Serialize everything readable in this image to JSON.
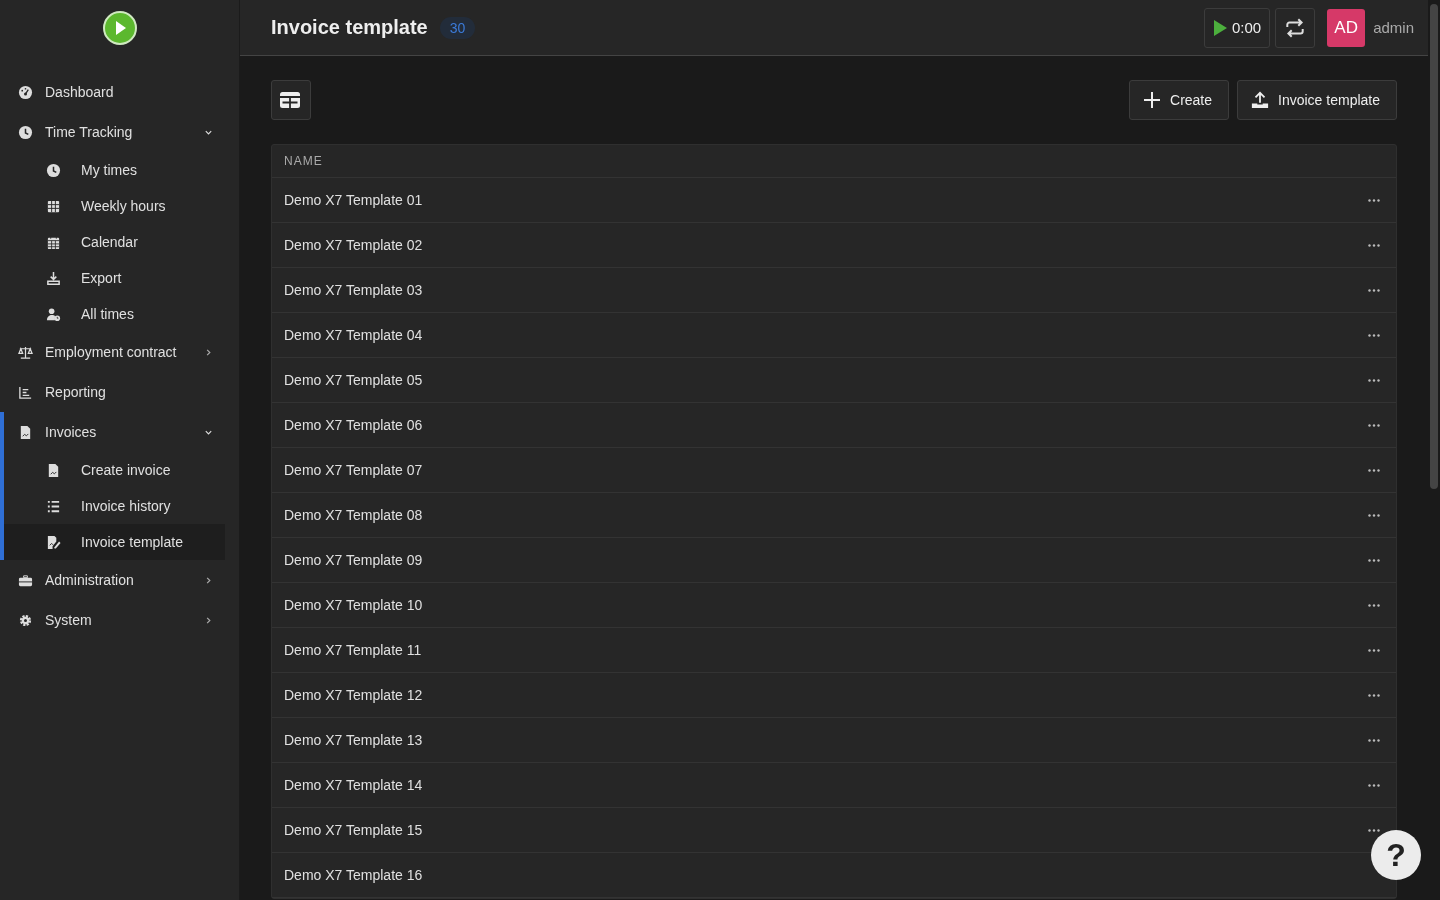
{
  "sidebar": {
    "items": [
      {
        "label": "Dashboard",
        "selected": false
      },
      {
        "label": "Time Tracking",
        "selected": false,
        "expanded": true,
        "children": [
          {
            "label": "My times",
            "selected": false
          },
          {
            "label": "Weekly hours",
            "selected": false
          },
          {
            "label": "Calendar",
            "selected": false
          },
          {
            "label": "Export",
            "selected": false
          },
          {
            "label": "All times",
            "selected": false
          }
        ]
      },
      {
        "label": "Employment contract",
        "selected": false,
        "expanded": false
      },
      {
        "label": "Reporting",
        "selected": false
      },
      {
        "label": "Invoices",
        "selected": true,
        "expanded": true,
        "children": [
          {
            "label": "Create invoice",
            "selected": false
          },
          {
            "label": "Invoice history",
            "selected": false
          },
          {
            "label": "Invoice template",
            "selected": true
          }
        ]
      },
      {
        "label": "Administration",
        "selected": false,
        "expanded": false
      },
      {
        "label": "System",
        "selected": false,
        "expanded": false
      }
    ]
  },
  "header": {
    "title": "Invoice template",
    "count": "30",
    "timer": "0:00",
    "avatar": "AD",
    "user": "admin"
  },
  "toolbar": {
    "buttons": [
      "Create",
      "Invoice template"
    ]
  },
  "table": {
    "columns": [
      "NAME"
    ],
    "rows": [
      {
        "name": "Demo X7 Template 01",
        "menu": true
      },
      {
        "name": "Demo X7 Template 02",
        "menu": true
      },
      {
        "name": "Demo X7 Template 03",
        "menu": true
      },
      {
        "name": "Demo X7 Template 04",
        "menu": true
      },
      {
        "name": "Demo X7 Template 05",
        "menu": true
      },
      {
        "name": "Demo X7 Template 06",
        "menu": true
      },
      {
        "name": "Demo X7 Template 07",
        "menu": true
      },
      {
        "name": "Demo X7 Template 08",
        "menu": true
      },
      {
        "name": "Demo X7 Template 09",
        "menu": true
      },
      {
        "name": "Demo X7 Template 10",
        "menu": true
      },
      {
        "name": "Demo X7 Template 11",
        "menu": true
      },
      {
        "name": "Demo X7 Template 12",
        "menu": true
      },
      {
        "name": "Demo X7 Template 13",
        "menu": true
      },
      {
        "name": "Demo X7 Template 14",
        "menu": true
      },
      {
        "name": "Demo X7 Template 15",
        "menu": true
      },
      {
        "name": "Demo X7 Template 16",
        "menu": false
      }
    ]
  },
  "help": {
    "label": "?"
  }
}
